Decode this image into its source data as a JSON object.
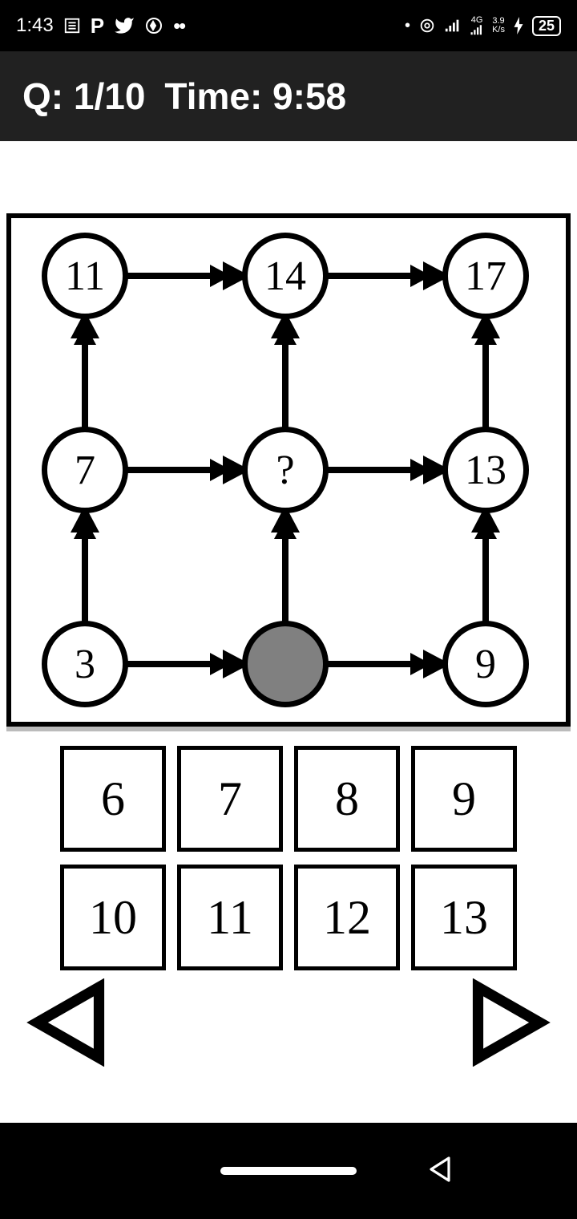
{
  "status": {
    "time": "1:43",
    "network_speed_top": "3.9",
    "network_speed_bottom": "K/s",
    "network_type": "4G",
    "battery": "25"
  },
  "header": {
    "question_label": "Q: 1/10",
    "time_label": "Time: 9:58"
  },
  "puzzle": {
    "nodes": {
      "r0c0": "11",
      "r0c1": "14",
      "r0c2": "17",
      "r1c0": "7",
      "r1c1": "?",
      "r1c2": "13",
      "r2c0": "3",
      "r2c1": "",
      "r2c2": "9"
    }
  },
  "answers": {
    "row1": [
      "6",
      "7",
      "8",
      "9"
    ],
    "row2": [
      "10",
      "11",
      "12",
      "13"
    ]
  }
}
